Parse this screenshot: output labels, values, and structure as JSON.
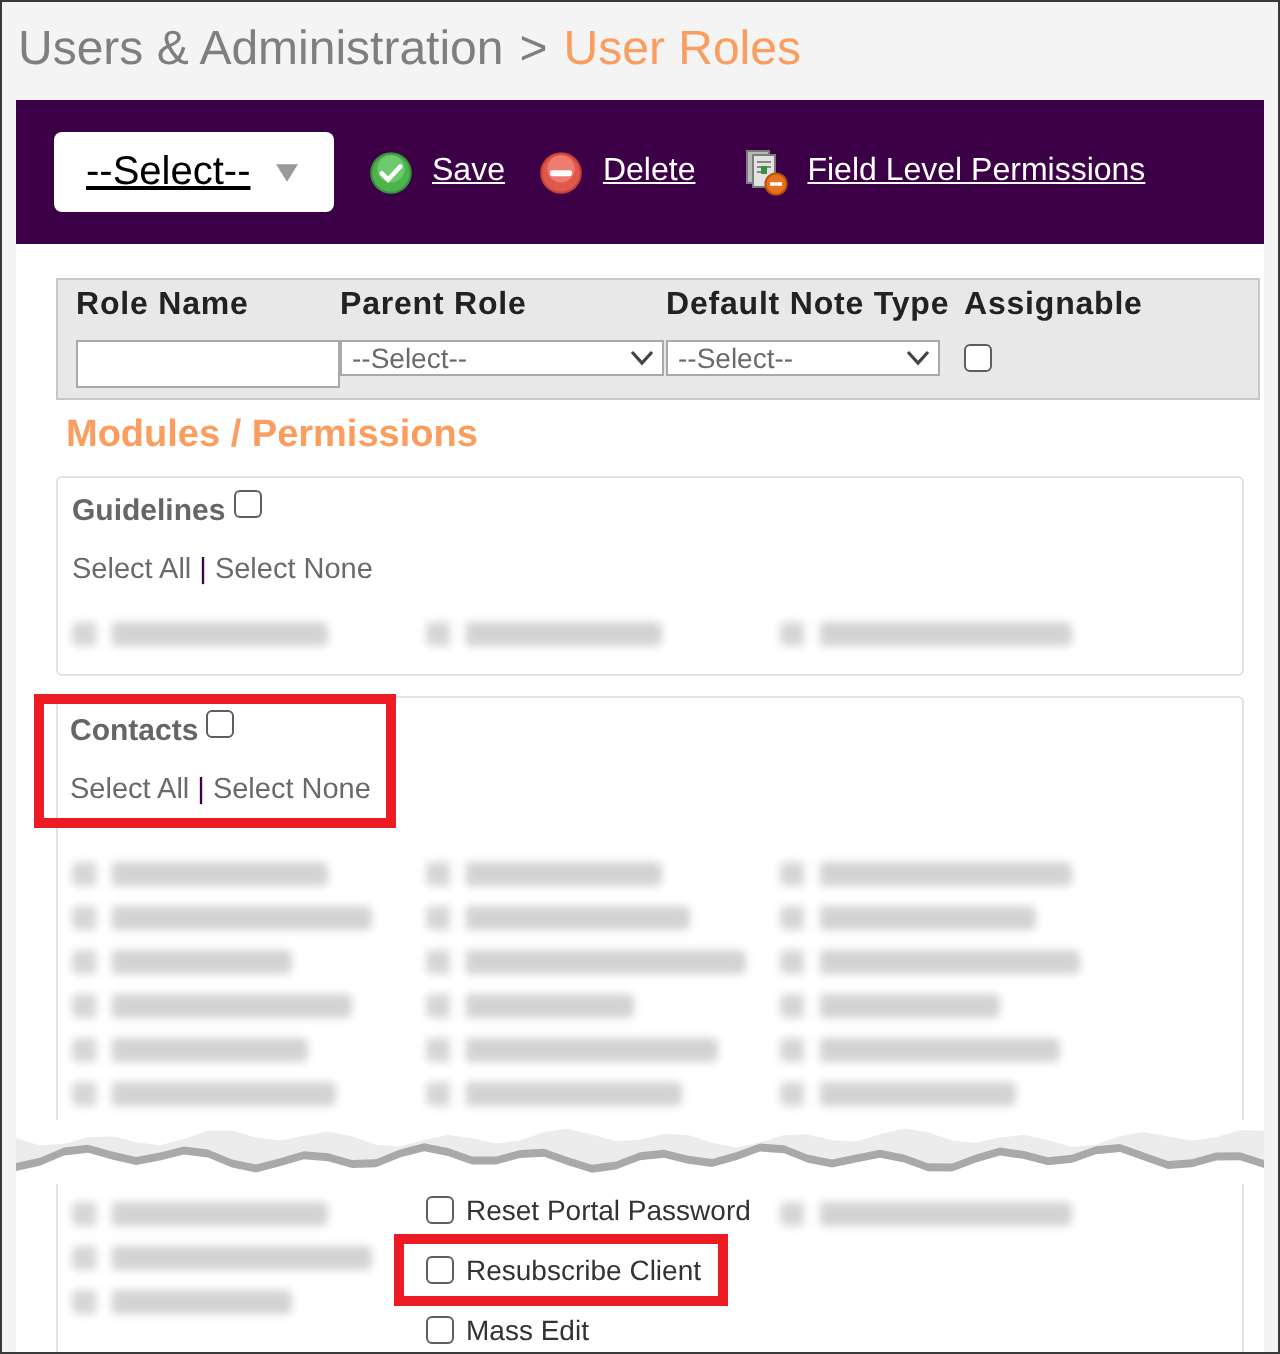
{
  "breadcrumb": {
    "parent": "Users & Administration",
    "separator": ">",
    "current": "User Roles"
  },
  "toolbar": {
    "role_select": {
      "value": "--Select--"
    },
    "actions": [
      {
        "kind": "save",
        "label": "Save"
      },
      {
        "kind": "delete",
        "label": "Delete"
      },
      {
        "kind": "field_permissions",
        "label": "Field Level Permissions"
      }
    ]
  },
  "role_form": {
    "fields": [
      {
        "kind": "text",
        "label": "Role Name"
      },
      {
        "kind": "select",
        "label": "Parent Role",
        "value": "--Select--"
      },
      {
        "kind": "select",
        "label": "Default Note Type",
        "value": "--Select--"
      },
      {
        "kind": "checkbox",
        "label": "Assignable",
        "checked": false
      }
    ]
  },
  "section_title": "Modules / Permissions",
  "modules": [
    {
      "name": "Guidelines",
      "checked": false,
      "highlighted": false,
      "select_all": "Select All",
      "separator": "|",
      "select_none": "Select None",
      "permission_columns": [
        [
          {
            "kind": "blurred"
          }
        ],
        [
          {
            "kind": "blurred"
          }
        ],
        [
          {
            "kind": "blurred"
          }
        ]
      ]
    },
    {
      "name": "Contacts",
      "checked": false,
      "highlighted": true,
      "select_all": "Select All",
      "separator": "|",
      "select_none": "Select None",
      "permission_columns": [
        [
          {
            "kind": "blurred"
          },
          {
            "kind": "blurred"
          },
          {
            "kind": "blurred"
          },
          {
            "kind": "blurred"
          },
          {
            "kind": "blurred"
          },
          {
            "kind": "blurred"
          }
        ],
        [
          {
            "kind": "blurred"
          },
          {
            "kind": "blurred"
          },
          {
            "kind": "blurred"
          },
          {
            "kind": "blurred"
          },
          {
            "kind": "blurred"
          },
          {
            "kind": "blurred"
          }
        ],
        [
          {
            "kind": "blurred"
          },
          {
            "kind": "blurred"
          },
          {
            "kind": "blurred"
          },
          {
            "kind": "blurred"
          },
          {
            "kind": "blurred"
          },
          {
            "kind": "blurred"
          }
        ]
      ]
    }
  ],
  "continuation": {
    "torn_edge": true,
    "permission_columns": [
      [
        {
          "kind": "blurred"
        },
        {
          "kind": "blurred"
        },
        {
          "kind": "blurred"
        }
      ],
      [
        {
          "kind": "checkbox",
          "label": "Reset Portal Password",
          "checked": false,
          "highlighted": false
        },
        {
          "kind": "checkbox",
          "label": "Resubscribe Client",
          "checked": false,
          "highlighted": true
        },
        {
          "kind": "checkbox",
          "label": "Mass Edit",
          "checked": false,
          "highlighted": false
        }
      ],
      [
        {
          "kind": "blurred"
        }
      ]
    ]
  }
}
